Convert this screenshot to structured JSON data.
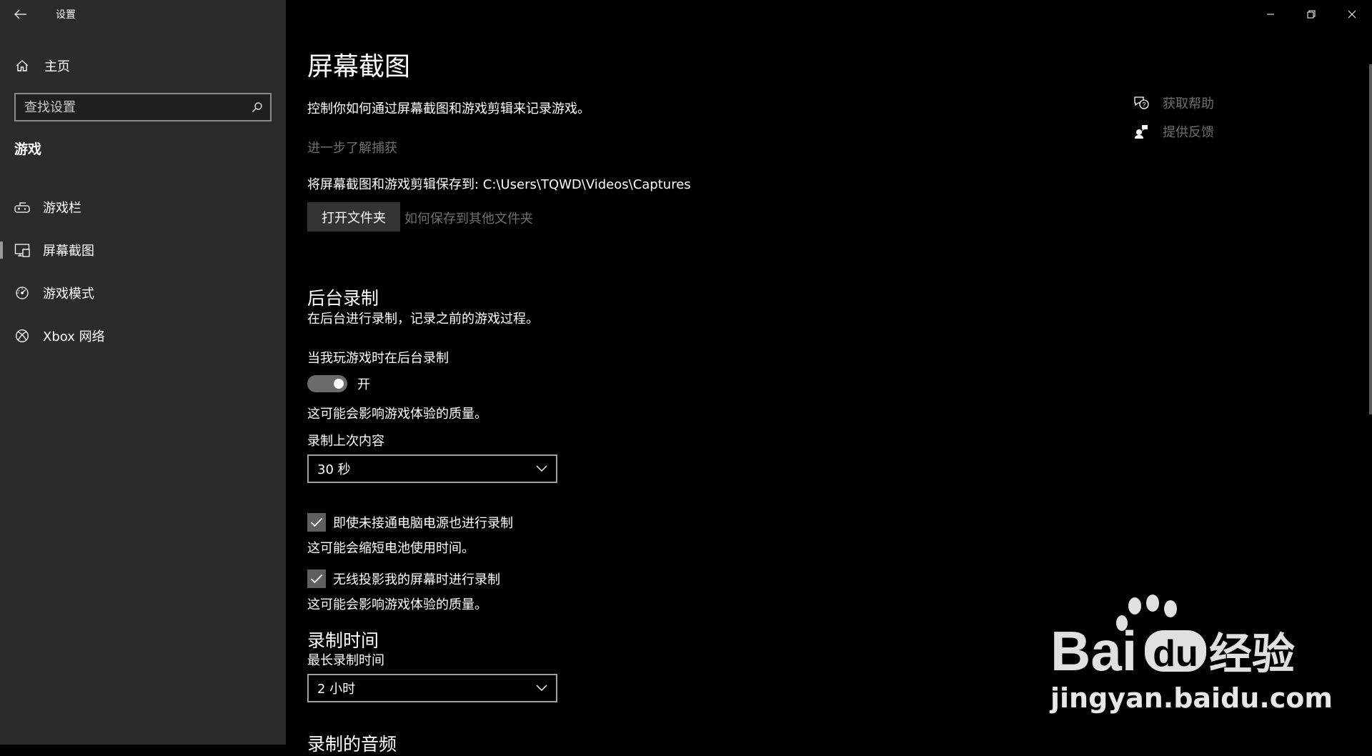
{
  "app": {
    "title": "设置"
  },
  "sidebar": {
    "home_label": "主页",
    "search_placeholder": "查找设置",
    "section_header": "游戏",
    "items": [
      {
        "label": "游戏栏",
        "icon": "game-bar-icon"
      },
      {
        "label": "屏幕截图",
        "icon": "captures-icon",
        "selected": true
      },
      {
        "label": "游戏模式",
        "icon": "game-mode-icon"
      },
      {
        "label": "Xbox 网络",
        "icon": "xbox-icon"
      }
    ]
  },
  "main": {
    "title": "屏幕截图",
    "description": "控制你如何通过屏幕截图和游戏剪辑来记录游戏。",
    "learn_more": "进一步了解捕获",
    "save_path_text": "将屏幕截图和游戏剪辑保存到: C:\\Users\\TQWD\\Videos\\Captures",
    "open_folder_button": "打开文件夹",
    "save_elsewhere_link": "如何保存到其他文件夹",
    "background_recording": {
      "heading": "后台录制",
      "description": "在后台进行录制，记录之前的游戏过程。",
      "toggle_label": "当我玩游戏时在后台录制",
      "toggle_state_text": "开",
      "toggle_on": true,
      "toggle_note": "这可能会影响游戏体验的质量。",
      "record_last_label": "录制上次内容",
      "record_last_value": "30 秒",
      "battery_check_label": "即使未接通电脑电源也进行录制",
      "battery_checked": true,
      "battery_note": "这可能会缩短电池使用时间。",
      "wireless_check_label": "无线投影我的屏幕时进行录制",
      "wireless_checked": true,
      "wireless_note": "这可能会影响游戏体验的质量。"
    },
    "recording_length": {
      "heading": "录制时间",
      "max_label": "最长录制时间",
      "max_value": "2 小时"
    },
    "next_heading": "录制的音频"
  },
  "help": {
    "get_help": "获取帮助",
    "feedback": "提供反馈"
  },
  "watermark": {
    "brand": "Bai du 经验",
    "url": "jingyan.baidu.com"
  },
  "colors": {
    "sidebar_bg": "#2b2b2b",
    "main_bg": "#000000",
    "muted_link": "#6e6e6e",
    "button_bg": "#333333"
  }
}
